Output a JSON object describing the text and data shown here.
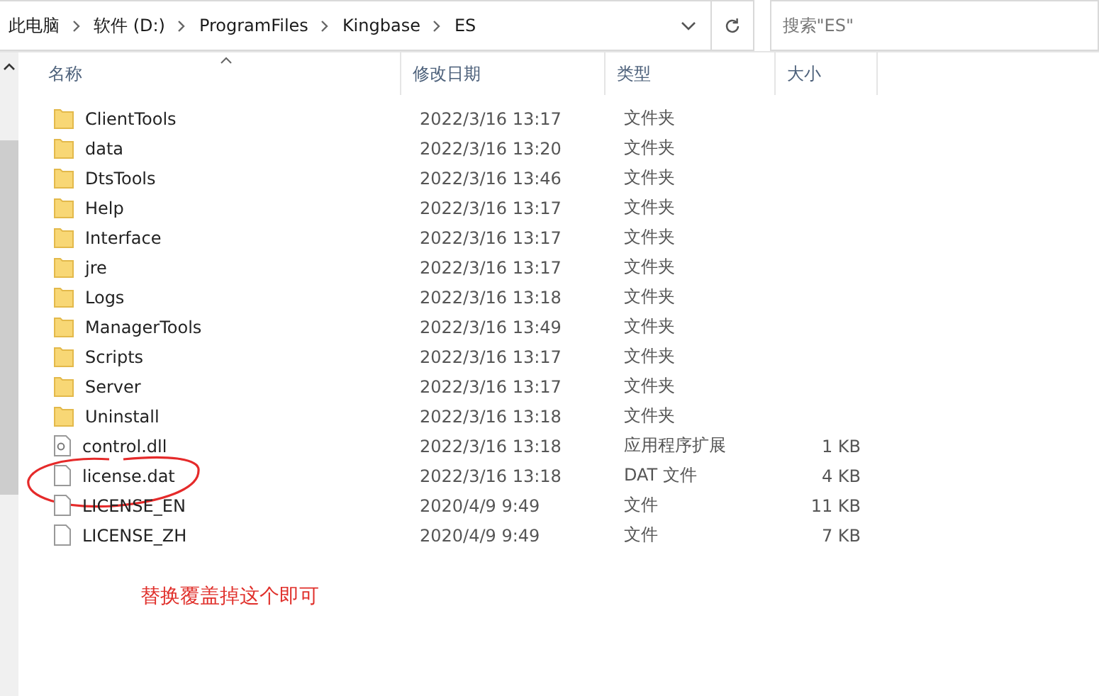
{
  "address_bar": {
    "crumbs": [
      "此电脑",
      "软件 (D:)",
      "ProgramFiles",
      "Kingbase",
      "ES"
    ]
  },
  "search": {
    "placeholder": "搜索\"ES\""
  },
  "columns": [
    {
      "label": "名称",
      "sorted": true
    },
    {
      "label": "修改日期",
      "sorted": false
    },
    {
      "label": "类型",
      "sorted": false
    },
    {
      "label": "大小",
      "sorted": false
    }
  ],
  "rows": [
    {
      "kind": "folder",
      "name": "ClientTools",
      "date": "2022/3/16 13:17",
      "type": "文件夹",
      "size": ""
    },
    {
      "kind": "folder",
      "name": "data",
      "date": "2022/3/16 13:20",
      "type": "文件夹",
      "size": ""
    },
    {
      "kind": "folder",
      "name": "DtsTools",
      "date": "2022/3/16 13:46",
      "type": "文件夹",
      "size": ""
    },
    {
      "kind": "folder",
      "name": "Help",
      "date": "2022/3/16 13:17",
      "type": "文件夹",
      "size": ""
    },
    {
      "kind": "folder",
      "name": "Interface",
      "date": "2022/3/16 13:17",
      "type": "文件夹",
      "size": ""
    },
    {
      "kind": "folder",
      "name": "jre",
      "date": "2022/3/16 13:17",
      "type": "文件夹",
      "size": ""
    },
    {
      "kind": "folder",
      "name": "Logs",
      "date": "2022/3/16 13:18",
      "type": "文件夹",
      "size": ""
    },
    {
      "kind": "folder",
      "name": "ManagerTools",
      "date": "2022/3/16 13:49",
      "type": "文件夹",
      "size": ""
    },
    {
      "kind": "folder",
      "name": "Scripts",
      "date": "2022/3/16 13:17",
      "type": "文件夹",
      "size": ""
    },
    {
      "kind": "folder",
      "name": "Server",
      "date": "2022/3/16 13:17",
      "type": "文件夹",
      "size": ""
    },
    {
      "kind": "folder",
      "name": "Uninstall",
      "date": "2022/3/16 13:18",
      "type": "文件夹",
      "size": ""
    },
    {
      "kind": "dll",
      "name": "control.dll",
      "date": "2022/3/16 13:18",
      "type": "应用程序扩展",
      "size": "1 KB"
    },
    {
      "kind": "file",
      "name": "license.dat",
      "date": "2022/3/16 13:18",
      "type": "DAT 文件",
      "size": "4 KB",
      "circled": true
    },
    {
      "kind": "file",
      "name": "LICENSE_EN",
      "date": "2020/4/9 9:49",
      "type": "文件",
      "size": "11 KB"
    },
    {
      "kind": "file",
      "name": "LICENSE_ZH",
      "date": "2020/4/9 9:49",
      "type": "文件",
      "size": "7 KB"
    }
  ],
  "annotation": "替换覆盖掉这个即可"
}
